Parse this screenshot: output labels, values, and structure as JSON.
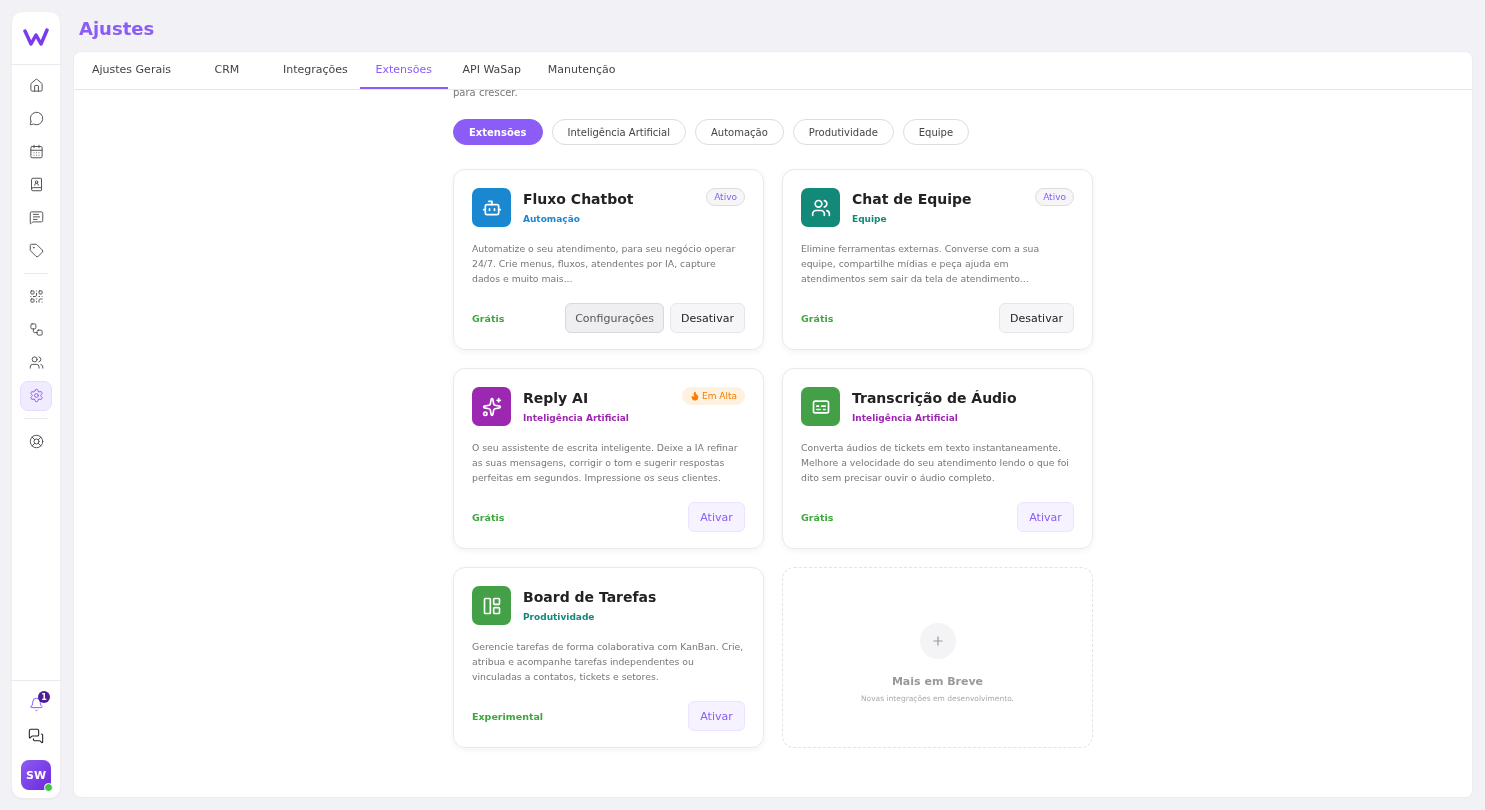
{
  "page_title": "Ajustes",
  "sidebar": {
    "items": [
      {
        "selected": false
      },
      {
        "selected": false
      },
      {
        "selected": false
      },
      {
        "selected": false
      },
      {
        "selected": false
      },
      {
        "selected": false
      },
      {
        "selected": false
      },
      {
        "selected": false
      },
      {
        "selected": false
      },
      {
        "selected": true
      },
      {
        "selected": false
      }
    ],
    "notification_count": "1",
    "avatar": "SW"
  },
  "tabs": [
    {
      "label": "Ajustes Gerais",
      "selected": false
    },
    {
      "label": "CRM",
      "selected": false
    },
    {
      "label": "Integrações",
      "selected": false
    },
    {
      "label": "Extensões",
      "selected": true
    },
    {
      "label": "API WaSap",
      "selected": false
    },
    {
      "label": "Manutenção",
      "selected": false
    }
  ],
  "intro_text": "para crescer.",
  "filters": [
    {
      "label": "Extensões",
      "selected": true
    },
    {
      "label": "Inteligência Artificial",
      "selected": false
    },
    {
      "label": "Automação",
      "selected": false
    },
    {
      "label": "Produtividade",
      "selected": false
    },
    {
      "label": "Equipe",
      "selected": false
    }
  ],
  "extensions": [
    {
      "name": "Fluxo Chatbot",
      "category": {
        "label": "Automação",
        "color": "#1a88d0"
      },
      "color": "#1a88d0",
      "badge": {
        "kind": "status",
        "label": "Ativo"
      },
      "description": "Automatize o seu atendimento, para seu negócio operar 24/7. Crie menus, fluxos, atendentes por IA, capture dados e muito mais...",
      "price": "Grátis",
      "buttons": [
        {
          "kind": "secondary",
          "label": "Configurações"
        },
        {
          "kind": "neutral",
          "label": "Desativar"
        }
      ]
    },
    {
      "name": "Chat de Equipe",
      "category": {
        "label": "Equipe",
        "color": "#13897a"
      },
      "color": "#13897a",
      "badge": {
        "kind": "status",
        "label": "Ativo"
      },
      "description": "Elimine ferramentas externas. Converse com a sua equipe, compartilhe mídias e peça ajuda em atendimentos sem sair da tela de atendimento...",
      "price": "Grátis",
      "buttons": [
        {
          "kind": "neutral",
          "label": "Desativar"
        }
      ]
    },
    {
      "name": "Reply AI",
      "category": {
        "label": "Inteligência Artificial",
        "color": "#9c27b0"
      },
      "color": "#9c27b0",
      "badge": {
        "kind": "trending",
        "label": "Em Alta"
      },
      "description": "O seu assistente de escrita inteligente. Deixe a IA refinar as suas mensagens, corrigir o tom e sugerir respostas perfeitas em segundos. Impressione os seus clientes.",
      "price": "Grátis",
      "buttons": [
        {
          "kind": "primary",
          "label": "Ativar"
        }
      ]
    },
    {
      "name": "Transcrição de Áudio",
      "category": {
        "label": "Inteligência Artificial",
        "color": "#9c27b0"
      },
      "color": "#43a047",
      "description": "Converta áudios de tickets em texto instantaneamente. Melhore a velocidade do seu atendimento lendo o que foi dito sem precisar ouvir o áudio completo.",
      "price": "Grátis",
      "buttons": [
        {
          "kind": "primary",
          "label": "Ativar"
        }
      ]
    },
    {
      "name": "Board de Tarefas",
      "category": {
        "label": "Produtividade",
        "color": "#13897a"
      },
      "color": "#43a047",
      "description": "Gerencie tarefas de forma colaborativa com KanBan. Crie, atribua e acompanhe tarefas independentes ou vinculadas a contatos, tickets e setores.",
      "price": "Experimental",
      "buttons": [
        {
          "kind": "primary",
          "label": "Ativar"
        }
      ]
    }
  ],
  "coming_soon": {
    "title": "Mais em Breve",
    "subtitle": "Novas integrações em desenvolvimento."
  }
}
